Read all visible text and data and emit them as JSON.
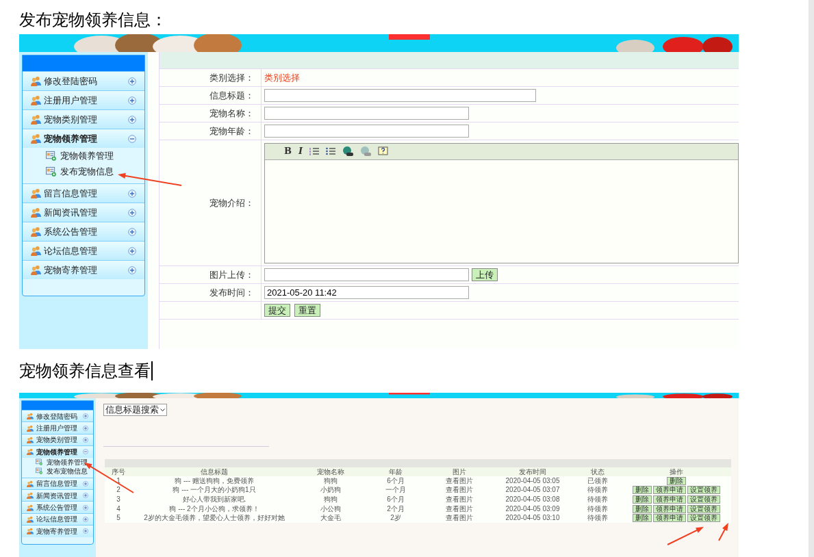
{
  "document": {
    "headings": [
      "发布宠物领养信息：",
      "宠物领养信息查看"
    ]
  },
  "screenshot_1": {
    "sidebar": [
      {
        "label": "修改登陆密码",
        "expanded": false
      },
      {
        "label": "注册用户管理",
        "expanded": false
      },
      {
        "label": "宠物类别管理",
        "expanded": false
      },
      {
        "label": "宠物领养管理",
        "expanded": true,
        "children": [
          {
            "label": "宠物领养管理"
          },
          {
            "label": "发布宠物信息"
          }
        ]
      },
      {
        "label": "留言信息管理",
        "expanded": false
      },
      {
        "label": "新闻资讯管理",
        "expanded": false
      },
      {
        "label": "系统公告管理",
        "expanded": false
      },
      {
        "label": "论坛信息管理",
        "expanded": false
      },
      {
        "label": "宠物寄养管理",
        "expanded": false
      }
    ],
    "form": [
      {
        "label": "类别选择：",
        "kind": "link",
        "value": "类别选择"
      },
      {
        "label": "信息标题：",
        "kind": "text",
        "wide": true
      },
      {
        "label": "宠物名称：",
        "kind": "text",
        "wide": false
      },
      {
        "label": "宠物年龄：",
        "kind": "text",
        "wide": false
      },
      {
        "label": "宠物介绍：",
        "kind": "editor",
        "toolbar": [
          "B",
          "I"
        ]
      },
      {
        "label": "图片上传：",
        "kind": "upload",
        "button": "上传"
      },
      {
        "label": "发布时间：",
        "kind": "text",
        "wide": false,
        "value": "2021-05-20 11:42"
      },
      {
        "kind": "buttons",
        "buttons": [
          "提交",
          "重置"
        ]
      }
    ]
  },
  "screenshot_2": {
    "sidebar": [
      {
        "label": "修改登陆密码",
        "expanded": false
      },
      {
        "label": "注册用户管理",
        "expanded": false
      },
      {
        "label": "宠物类别管理",
        "expanded": false
      },
      {
        "label": "宠物领养管理",
        "expanded": true,
        "children": [
          {
            "label": "宠物领养管理"
          },
          {
            "label": "发布宠物信息"
          }
        ]
      },
      {
        "label": "留言信息管理",
        "expanded": false
      },
      {
        "label": "新闻资讯管理",
        "expanded": false
      },
      {
        "label": "系统公告管理",
        "expanded": false
      },
      {
        "label": "论坛信息管理",
        "expanded": false
      },
      {
        "label": "宠物寄养管理",
        "expanded": false
      }
    ],
    "search_select": "信息标题搜索",
    "table": {
      "columns": [
        "序号",
        "信息标题",
        "宠物名称",
        "年龄",
        "图片",
        "发布时间",
        "状态",
        "操作"
      ],
      "rows": [
        {
          "cells": [
            "1",
            "狗 --- 赠送狗狗，免费领养",
            "狗狗",
            "6个月",
            "查看图片",
            "2020-04-05 03:05",
            "已领养"
          ],
          "actions": [
            "删除"
          ]
        },
        {
          "cells": [
            "2",
            "狗 --- 一个月大的小奶狗1只",
            "小奶狗",
            "一个月",
            "查看图片",
            "2020-04-05 03:07",
            "待领养"
          ],
          "actions": [
            "删除",
            "领养申请",
            "设置领养"
          ]
        },
        {
          "cells": [
            "3",
            "好心人带我到新家吧.",
            "狗狗",
            "6个月",
            "查看图片",
            "2020-04-05 03:08",
            "待领养"
          ],
          "actions": [
            "删除",
            "领养申请",
            "设置领养"
          ]
        },
        {
          "cells": [
            "4",
            "狗 --- 2个月小公狗，求领养！",
            "小公狗",
            "2个月",
            "查看图片",
            "2020-04-05 03:09",
            "待领养"
          ],
          "actions": [
            "删除",
            "领养申请",
            "设置领养"
          ]
        },
        {
          "cells": [
            "5",
            "2岁的大金毛领养，望爱心人士领养，好好对她",
            "大金毛",
            "2岁",
            "查看图片",
            "2020-04-05 03:10",
            "待领养"
          ],
          "actions": [
            "删除",
            "领养申请",
            "设置领养"
          ]
        }
      ]
    }
  }
}
